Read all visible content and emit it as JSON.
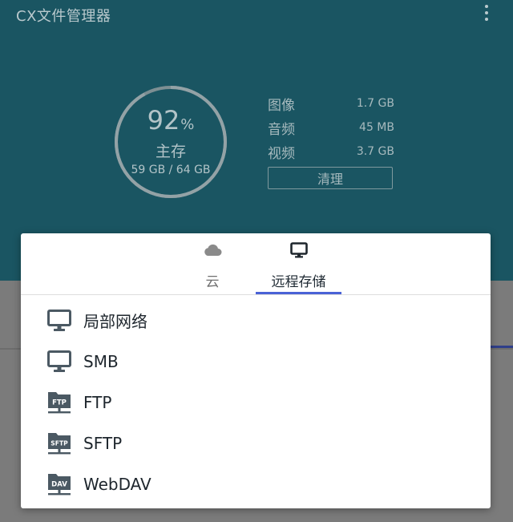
{
  "app": {
    "title": "CX文件管理器"
  },
  "storage": {
    "percent": "92",
    "percent_sign": "%",
    "used_fraction": 0.92,
    "label": "主存",
    "size": "59 GB / 64 GB",
    "stats": [
      {
        "name": "图像",
        "value": "1.7 GB"
      },
      {
        "name": "音频",
        "value": "45 MB"
      },
      {
        "name": "视频",
        "value": "3.7 GB"
      }
    ],
    "clean_label": "清理"
  },
  "dialog": {
    "tabs": [
      {
        "label": "云",
        "icon": "cloud-icon",
        "selected": false
      },
      {
        "label": "远程存储",
        "icon": "monitor-icon",
        "selected": true
      }
    ],
    "items": [
      {
        "label": "局部网络",
        "icon": "monitor-icon"
      },
      {
        "label": "SMB",
        "icon": "monitor-icon"
      },
      {
        "label": "FTP",
        "icon": "ftp-server-icon",
        "badge": "FTP"
      },
      {
        "label": "SFTP",
        "icon": "sftp-server-icon",
        "badge": "SFTP"
      },
      {
        "label": "WebDAV",
        "icon": "webdav-server-icon",
        "badge": "DAV"
      }
    ]
  },
  "colors": {
    "header": "#1a5562",
    "accent": "#4a62d6",
    "icon": "#4b5963"
  }
}
